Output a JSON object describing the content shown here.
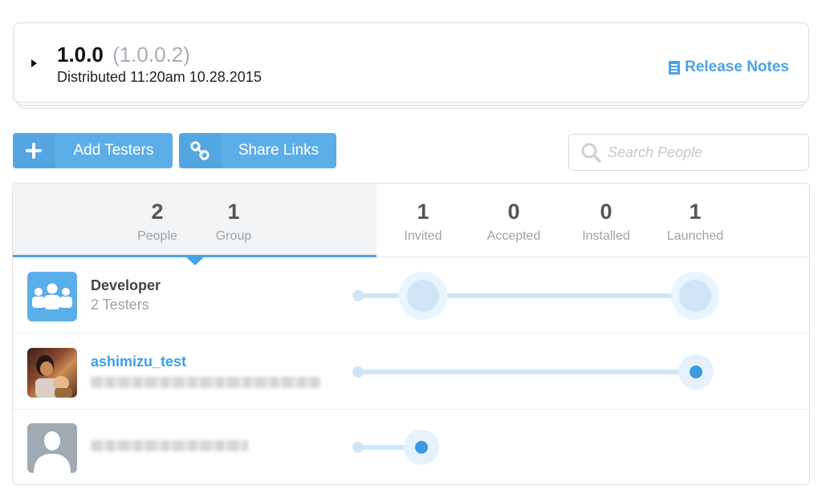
{
  "release": {
    "version": "1.0.0",
    "build": "(1.0.0.2)",
    "distributed": "Distributed 11:20am 10.28.2015",
    "release_notes_label": "Release Notes"
  },
  "toolbar": {
    "add_testers_label": "Add Testers",
    "share_links_label": "Share Links",
    "search_placeholder": "Search People"
  },
  "stats": {
    "people": {
      "value": "2",
      "label": "People"
    },
    "group": {
      "value": "1",
      "label": "Group"
    },
    "invited": {
      "value": "1",
      "label": "Invited"
    },
    "accepted": {
      "value": "0",
      "label": "Accepted"
    },
    "installed": {
      "value": "0",
      "label": "Installed"
    },
    "launched": {
      "value": "1",
      "label": "Launched"
    }
  },
  "rows": [
    {
      "name": "Developer",
      "subtitle": "2 Testers",
      "type": "group"
    },
    {
      "name": "ashimizu_test",
      "subtitle": "",
      "type": "person-photo"
    },
    {
      "name": "",
      "subtitle": "",
      "type": "person-default"
    }
  ],
  "colors": {
    "accent": "#4aa3e3",
    "button": "#5caee8",
    "track": "#cfe6f8",
    "panel_bg": "#f3f4f5"
  }
}
